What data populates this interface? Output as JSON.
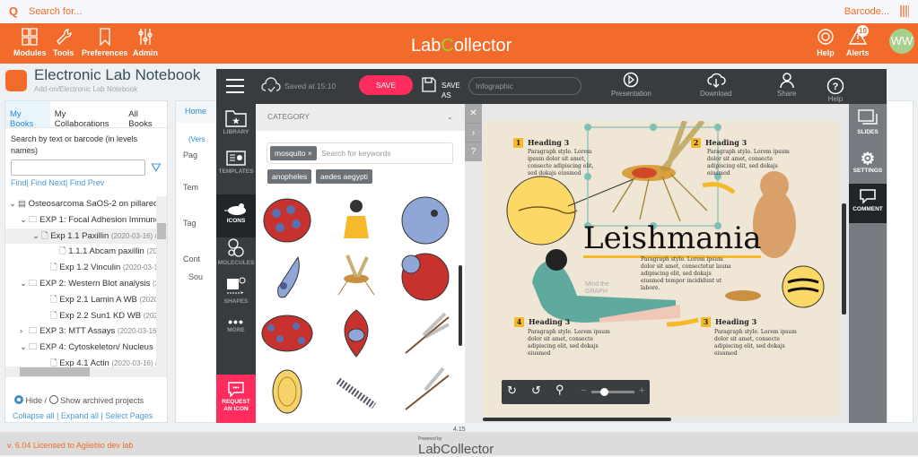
{
  "topbar": {
    "search_placeholder": "Search for...",
    "barcode": "Barcode..."
  },
  "header": {
    "items": [
      "Modules",
      "Tools",
      "Preferences",
      "Admin"
    ],
    "logo_left": "Lab",
    "logo_c": "C",
    "logo_right": "ollector",
    "help": "Help",
    "alerts": "Alerts",
    "alerts_count": "10",
    "avatar": "WW",
    "brand_color": "#f26b2a"
  },
  "eln": {
    "title": "Electronic Lab Notebook",
    "subtitle": "Add-on/Electronic Lab Notebook"
  },
  "left": {
    "tabs": [
      "My Books",
      "My Collaborations",
      "All Books"
    ],
    "search_label": "Search by text or barcode (in levels names)",
    "find": "Find",
    "find_next": "Find Next",
    "find_prev": "Find Prev",
    "tree": [
      {
        "t": "Osteosarcoma SaOS-2 on pillared b",
        "m": "",
        "arrow": "⌄",
        "ind": 4
      },
      {
        "t": "EXP 1: Focal Adhesion Immunofl",
        "m": "",
        "arrow": "⌄",
        "ind": 16
      },
      {
        "t": "Exp 1.1 Paxillin",
        "m": "(2020-03-16) #267",
        "arrow": "⌄",
        "ind": 30
      },
      {
        "t": "1.1.1 Abcam paxillin",
        "m": "(2020-03-16)",
        "arrow": "",
        "ind": 50
      },
      {
        "t": "Exp 1.2 Vinculin",
        "m": "(2020-03-16) #268",
        "arrow": "",
        "ind": 40
      },
      {
        "t": "EXP 2: Western Blot analysis",
        "m": "(2020-03-16)",
        "arrow": "⌄",
        "ind": 16
      },
      {
        "t": "Exp 2.1 Lamin A WB",
        "m": "(2020-03-16)",
        "arrow": "",
        "ind": 40
      },
      {
        "t": "Exp 2.2 Sun1 KD WB",
        "m": "(2020-03-16)",
        "arrow": "",
        "ind": 40
      },
      {
        "t": "EXP 3: MTT Assays",
        "m": "(2020-03-16) #1",
        "arrow": "›",
        "ind": 16
      },
      {
        "t": "EXP 4: Cytoskeleton/ Nucleus Im",
        "m": "",
        "arrow": "⌄",
        "ind": 16
      },
      {
        "t": "Exp 4.1 Actin",
        "m": "(2020-03-16) #266",
        "arrow": "",
        "ind": 40
      }
    ],
    "hide": "Hide /",
    "show_archived": "Show archived projects",
    "collapse": "Collapse all",
    "expand": "Expand all",
    "select_pages": "Select Pages"
  },
  "main": {
    "breadcrumb_home": "Home",
    "version": "(Vers",
    "sections": [
      "Pag",
      "Tem",
      "Tag",
      "Cont"
    ],
    "source": "Sou"
  },
  "editor": {
    "saved": "Saved at 15:10",
    "save": "SAVE",
    "save_as": "SAVE AS",
    "title_value": "Infographic",
    "presentation": "Presentation",
    "download": "Download",
    "share": "Share",
    "help": "Help",
    "nav": [
      "LIBRARY",
      "TEMPLATES",
      "ICONS",
      "MOLECULES",
      "SHAPES",
      "MORE"
    ],
    "request": "REQUEST AN ICON",
    "category": "CATEGORY",
    "keyword": "mosquito",
    "keyword_placeholder": "Search for keywords",
    "suggestions": [
      "anopheles",
      "aedes aegypti"
    ],
    "right": [
      "SLIDES",
      "SETTINGS",
      "COMMENT"
    ],
    "accent": "#ff2d5e"
  },
  "canvas": {
    "title": "Leishmania",
    "watermark": "Mind the GRAPH",
    "heading": "Heading 3",
    "blocks": [
      {
        "n": "1",
        "p": "Paragraph style. Lorem ipsum dolor sit amet, consecte adipiscing elit, sed dokajs eiusmod"
      },
      {
        "n": "2",
        "p": "Paragraph style. Lorem ipsum dolor sit amet, consecte adipiscing elit, sed dokajs eiusmod"
      },
      {
        "n": "3",
        "p": "Paragraph style. Lorem ipsum dolor sit amet, consecte adipiscing elit, sed dokajs eiusmod"
      },
      {
        "n": "4",
        "p": "Paragraph style. Lorem ipsum dolor sit amet, consecte adipiscing elit, sed dokajs eiusmod"
      }
    ],
    "center_para": "Paragraph style. Lorem ipsum dolor sit amet, consectetur launa adipiscing elit, sed dokajs eiusmod tempor incididunt ut labore.",
    "zoom_level": 0.3
  },
  "footer": {
    "license": "v. 6.04 Licensed to Agilebio dev lab",
    "version": "4.15",
    "powered": "Powered by",
    "brand": "LabCollector"
  }
}
